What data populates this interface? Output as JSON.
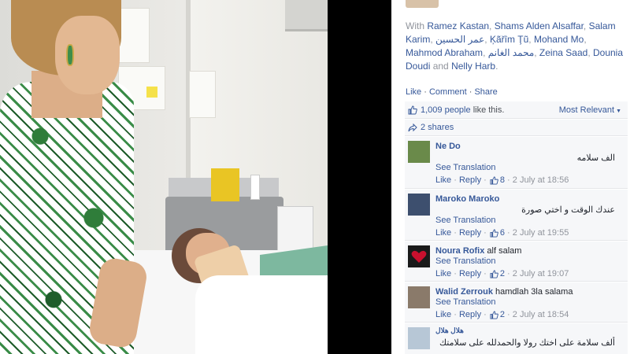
{
  "post": {
    "tagged_prefix": "With",
    "tagged_names": [
      "Ramez Kastan",
      "Shams Alden Alsaffar",
      "Salam Karim",
      "عمر الحسين",
      "Ķãřîm Ţũ",
      "Mohand Mo",
      "Mahmod Abraham",
      "محمد الغانم",
      "Zeina Saad",
      "Dounia Doudi"
    ],
    "tagged_and": "and",
    "tagged_last": "Nelly Harb",
    "actions": {
      "like": "Like",
      "sep": " · ",
      "comment": "Comment",
      "share": "Share"
    },
    "likes_count": "1,009 people",
    "likes_suffix": "like this.",
    "sort_label": "Most Relevant",
    "shares_label": "2 shares"
  },
  "comments": [
    {
      "author": "Ne Do",
      "text": "الف سلامه",
      "see_translation": "See Translation",
      "like": "Like",
      "reply": "Reply",
      "likes": "8",
      "date": "2 July at 18:56",
      "avatar_color": "#6a8a4a"
    },
    {
      "author": "Maroko Maroko",
      "text": "عندك الوقت و اختي صورة",
      "see_translation": "See Translation",
      "like": "Like",
      "reply": "Reply",
      "likes": "6",
      "date": "2 July at 19:55",
      "avatar_color": "#3d4f6e"
    },
    {
      "author": "Noura Rofix",
      "text": "alf salam",
      "see_translation": "See Translation",
      "like": "Like",
      "reply": "Reply",
      "likes": "2",
      "date": "2 July at 19:07",
      "avatar_color": "#c8102e"
    },
    {
      "author": "Walid Zerrouk",
      "text": "hamdlah 3la salama",
      "see_translation": "See Translation",
      "like": "Like",
      "reply": "Reply",
      "likes": "2",
      "date": "2 July at 18:54",
      "avatar_color": "#8a7a6a"
    },
    {
      "author": "هلال هلال",
      "text": "ألف سلامة على اختك رولا والحمدلله على سلامتك",
      "avatar_color": "#b7c7d6"
    }
  ],
  "colors": {
    "link": "#365899",
    "muted": "#90949c",
    "panel_bg": "#f6f7f9"
  }
}
